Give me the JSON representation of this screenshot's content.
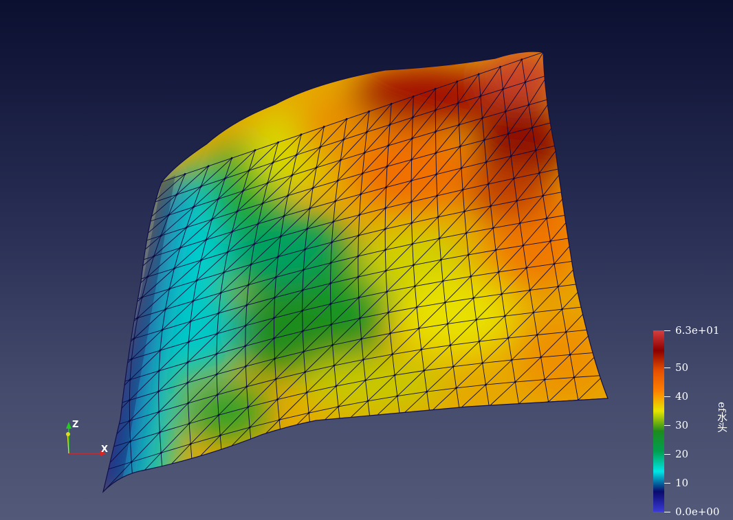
{
  "scene": {
    "field_name": "ef水头",
    "surface_colormap": "jet",
    "mesh": "triangulated quad grid"
  },
  "colorbar": {
    "title": "ef水头",
    "range": [
      0,
      63
    ],
    "ticks": [
      {
        "value": 63,
        "label": "6.3e+01"
      },
      {
        "value": 50,
        "label": "50"
      },
      {
        "value": 40,
        "label": "40"
      },
      {
        "value": 30,
        "label": "30"
      },
      {
        "value": 20,
        "label": "20"
      },
      {
        "value": 10,
        "label": "10"
      },
      {
        "value": 0,
        "label": "0.0e+00"
      }
    ],
    "colors": [
      "#3b3bd6",
      "#0a0a6e",
      "#00e6e6",
      "#00a050",
      "#1e8c1e",
      "#e6e600",
      "#ff8000",
      "#e65000",
      "#8c0000",
      "#d64040"
    ]
  },
  "axes": {
    "z_label": "Z",
    "x_label": "X",
    "z_color": "#22cc22",
    "x_color": "#dd2222",
    "y_color": "#dddd22"
  }
}
